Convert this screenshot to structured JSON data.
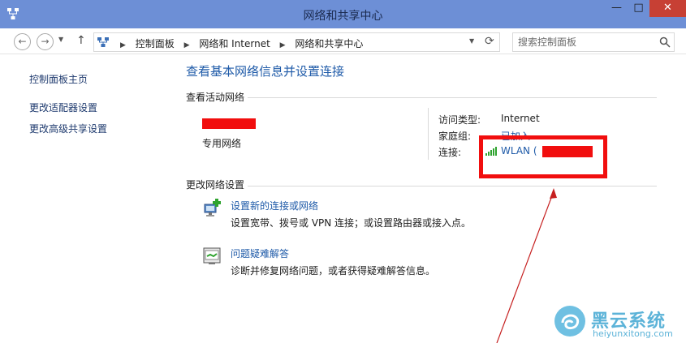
{
  "window": {
    "title": "网络和共享中心",
    "min_glyph": "—",
    "max_glyph": "□",
    "close_glyph": "✕"
  },
  "nav": {
    "back_glyph": "←",
    "forward_glyph": "→",
    "up_glyph": "↑",
    "breadcrumb": [
      "控制面板",
      "网络和 Internet",
      "网络和共享中心"
    ],
    "search_placeholder": "搜索控制面板"
  },
  "sidebar": {
    "items": [
      {
        "label": "控制面板主页"
      },
      {
        "label": "更改适配器设置"
      },
      {
        "label": "更改高级共享设置"
      }
    ]
  },
  "main": {
    "heading": "查看基本网络信息并设置连接",
    "active_networks": {
      "section_title": "查看活动网络",
      "network_type": "专用网络",
      "access_type_label": "访问类型:",
      "access_type_value": "Internet",
      "homegroup_label": "家庭组:",
      "homegroup_value": "已加入",
      "connection_label": "连接:",
      "connection_value": "WLAN ("
    },
    "change_settings": {
      "section_title": "更改网络设置",
      "tasks": [
        {
          "title": "设置新的连接或网络",
          "desc": "设置宽带、拨号或 VPN 连接；或设置路由器或接入点。",
          "icon": "network-setup-icon"
        },
        {
          "title": "问题疑难解答",
          "desc": "诊断并修复网络问题，或者获得疑难解答信息。",
          "icon": "troubleshoot-icon"
        }
      ]
    }
  },
  "watermark": {
    "title": "黑云系统",
    "url": "heiyunxitong.com"
  },
  "colors": {
    "titlebar": "#6d8fd6",
    "link": "#1e5aa8",
    "annotation": "#f10e0e",
    "watermark": "#5cb3d8"
  }
}
